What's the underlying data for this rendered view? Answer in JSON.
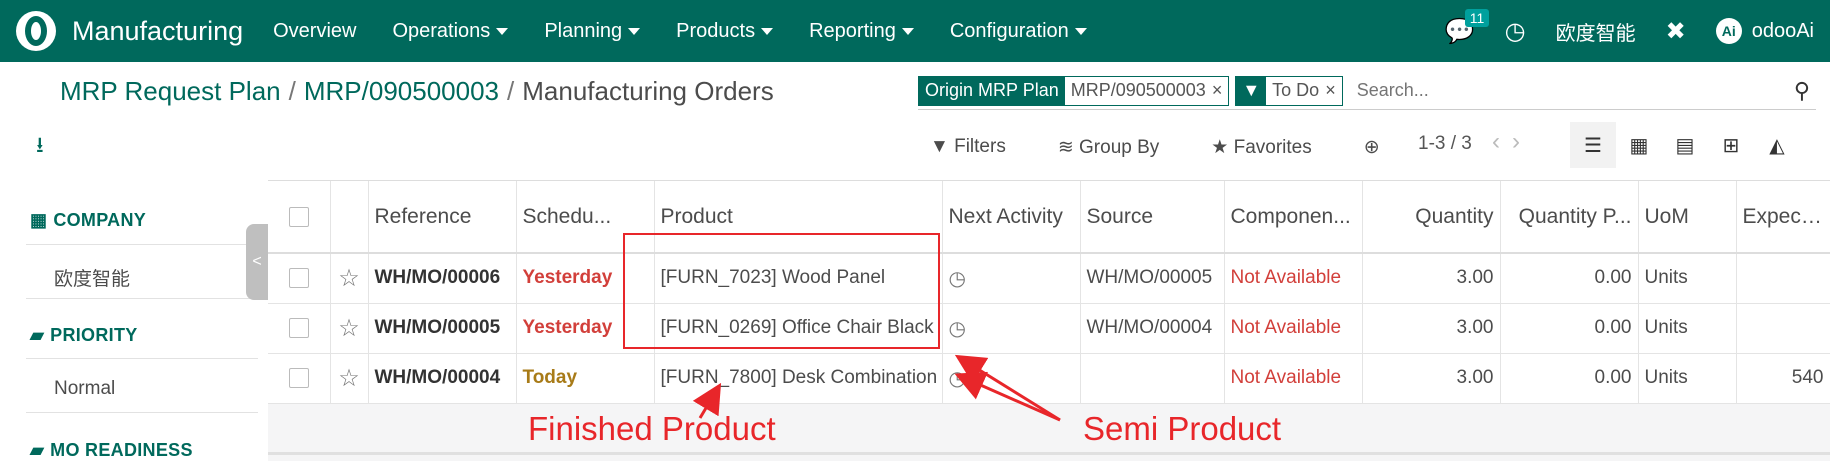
{
  "navbar": {
    "app_name": "Manufacturing",
    "menus": [
      "Overview",
      "Operations",
      "Planning",
      "Products",
      "Reporting",
      "Configuration"
    ],
    "menus_with_caret": [
      false,
      true,
      true,
      true,
      true,
      true
    ],
    "message_count": "11",
    "company": "欧度智能",
    "user": "odooAi",
    "avatar_text": "Ai"
  },
  "breadcrumb": {
    "items": [
      "MRP Request Plan",
      "MRP/090500003",
      "Manufacturing Orders"
    ]
  },
  "search": {
    "facets": [
      {
        "name": "Origin MRP Plan",
        "value": "MRP/090500003"
      },
      {
        "name": "▼",
        "value": "To Do"
      }
    ],
    "placeholder": "Search..."
  },
  "filters": {
    "filters_label": "Filters",
    "groupby_label": "Group By",
    "favorites_label": "Favorites"
  },
  "pager": {
    "text": "1-3 / 3"
  },
  "sidebar": {
    "company_head": "COMPANY",
    "company_value": "欧度智能",
    "priority_head": "PRIORITY",
    "priority_value": "Normal",
    "readiness_head": "MO READINESS"
  },
  "table": {
    "headers": [
      "Reference",
      "Schedu...",
      "Product",
      "Next Activity",
      "Source",
      "Componen...",
      "Quantity",
      "Quantity P...",
      "UoM",
      "Expected"
    ],
    "rows": [
      {
        "ref": "WH/MO/00006",
        "scheduled": "Yesterday",
        "product": "[FURN_7023] Wood Panel",
        "source": "WH/MO/00005",
        "components": "Not Available",
        "qty": "3.00",
        "qty_produced": "0.00",
        "uom": "Units",
        "expected": ""
      },
      {
        "ref": "WH/MO/00005",
        "scheduled": "Yesterday",
        "product": "[FURN_0269] Office Chair Black",
        "source": "WH/MO/00004",
        "components": "Not Available",
        "qty": "3.00",
        "qty_produced": "0.00",
        "uom": "Units",
        "expected": ""
      },
      {
        "ref": "WH/MO/00004",
        "scheduled": "Today",
        "product": "[FURN_7800] Desk Combination",
        "source": "",
        "components": "Not Available",
        "qty": "3.00",
        "qty_produced": "0.00",
        "uom": "Units",
        "expected": "540"
      }
    ]
  },
  "annotations": {
    "finished": "Finished Product",
    "semi": "Semi Product",
    "color": "#e8262a"
  },
  "colors": {
    "brand": "#00695c",
    "danger": "#d23f3a",
    "warning": "#a87b18"
  }
}
